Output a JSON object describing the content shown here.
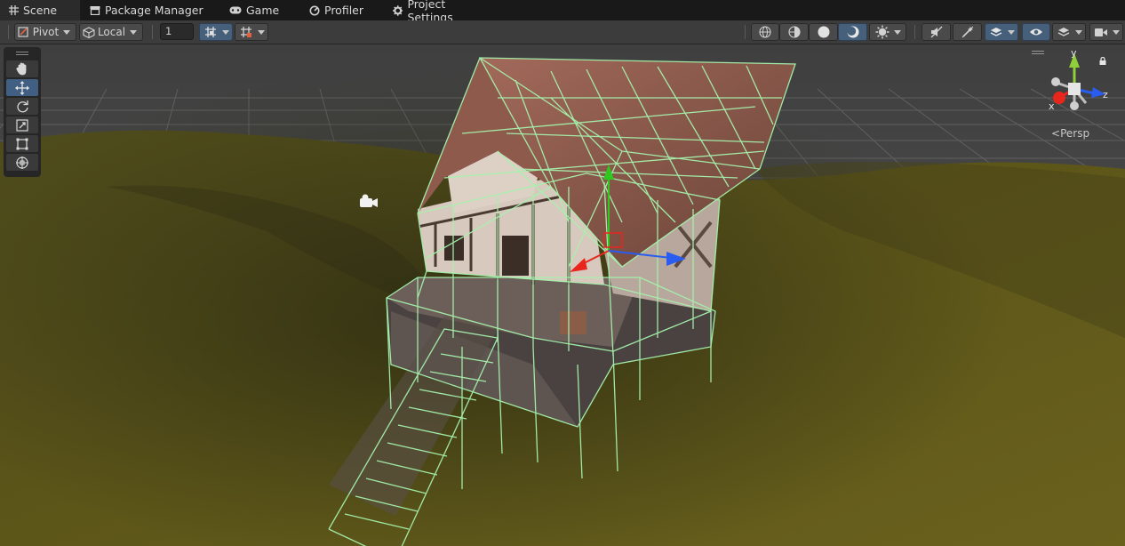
{
  "tabs": [
    {
      "label": "Scene",
      "icon": "grid-icon",
      "active": true
    },
    {
      "label": "Package Manager",
      "icon": "package-icon"
    },
    {
      "label": "Game",
      "icon": "gamepad-icon"
    },
    {
      "label": "Profiler",
      "icon": "profiler-icon"
    },
    {
      "label": "Project Settings",
      "icon": "gear-icon"
    }
  ],
  "toolbar": {
    "pivot_label": "Pivot",
    "local_label": "Local",
    "snap_value": "1"
  },
  "tools": [
    "hand-tool",
    "move-tool",
    "rotate-tool",
    "scale-tool",
    "rect-tool",
    "transform-tool"
  ],
  "gizmo": {
    "axis_y": "y",
    "axis_z": "z",
    "axis_x": "x",
    "projection_label": "Persp"
  },
  "colors": {
    "selection_wire": "#9df0a8",
    "terrain": "#5c5518",
    "axis_x": "#e8261c",
    "axis_y": "#2ec81f",
    "axis_z": "#2a5cf0"
  }
}
